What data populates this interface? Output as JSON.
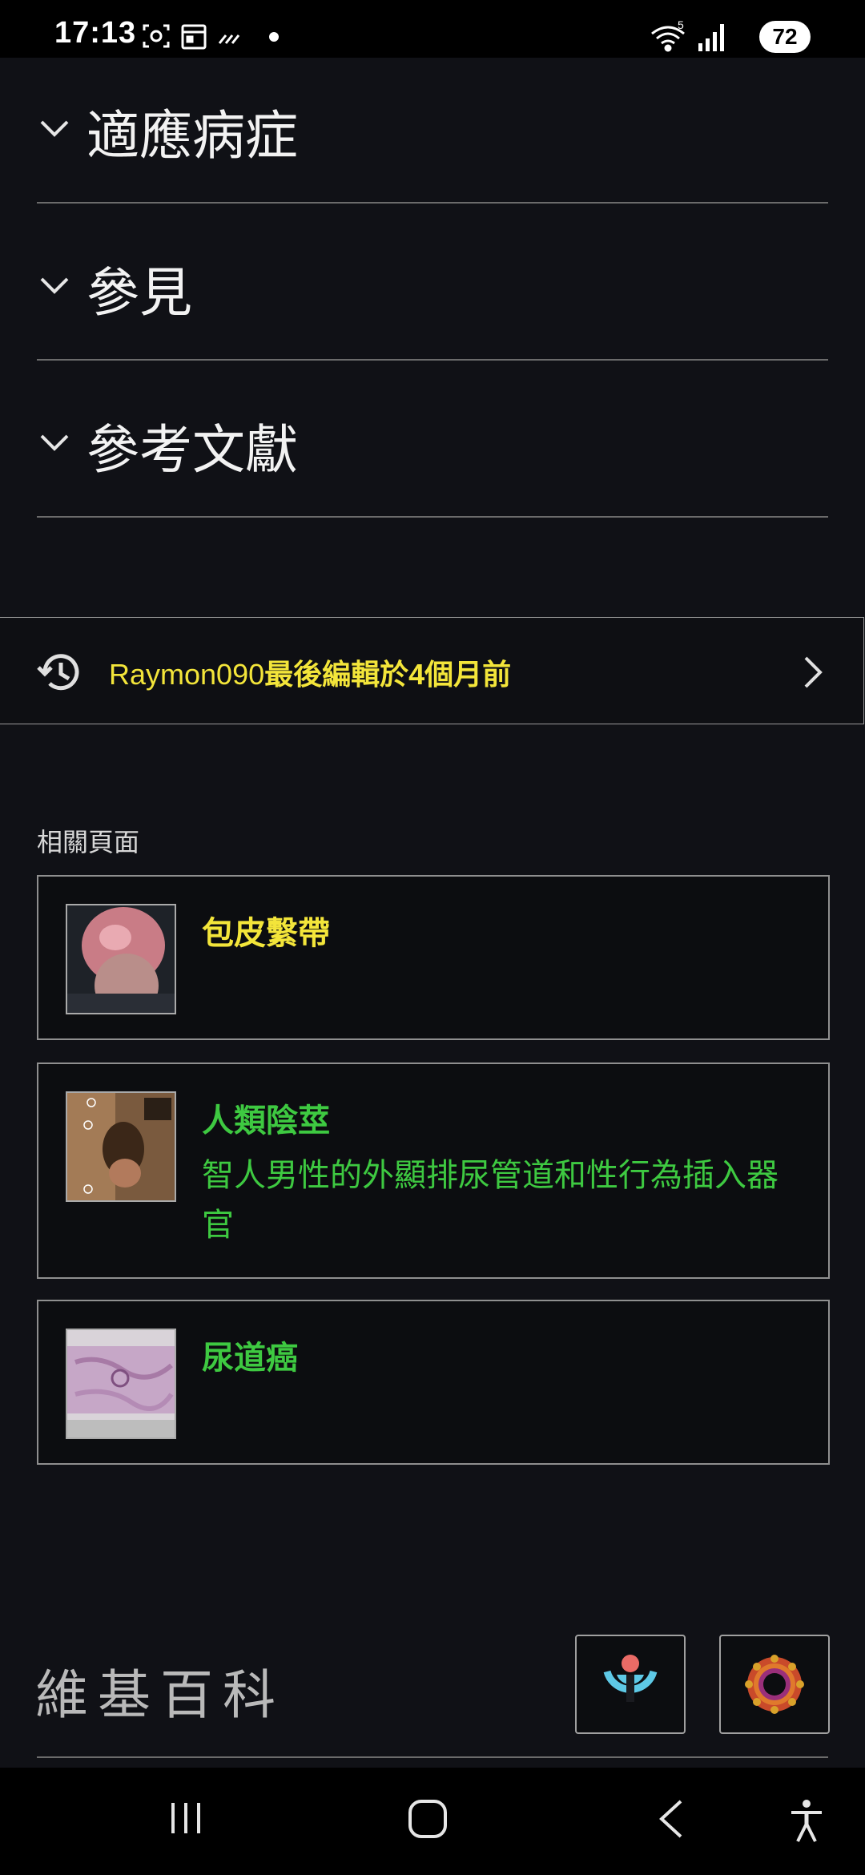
{
  "status_bar": {
    "time": "17:13",
    "battery": "72",
    "icons": [
      "screenshot-icon",
      "calendar-icon",
      "missed-call-icon",
      "dot-icon",
      "wifi-icon",
      "signal-icon"
    ]
  },
  "sections": [
    {
      "title": "適應病症"
    },
    {
      "title": "參見"
    },
    {
      "title": "參考文獻"
    }
  ],
  "last_edit": {
    "user": "Raymon090",
    "text": "最後編輯於4個月前"
  },
  "related": {
    "heading": "相關頁面",
    "items": [
      {
        "title": "包皮繫帶",
        "description": "",
        "title_color": "#f3e53a"
      },
      {
        "title": "人類陰莖",
        "description": "智人男性的外顯排尿管道和性行為插入器官",
        "title_color": "#3ec941"
      },
      {
        "title": "尿道癌",
        "description": "",
        "title_color": "#3ec941"
      }
    ]
  },
  "footer": {
    "logo_text": "維基百科"
  },
  "colors": {
    "background": "#101116",
    "link_yellow": "#f3e53a",
    "link_green": "#3ec941",
    "divider": "#6b6b6b"
  }
}
